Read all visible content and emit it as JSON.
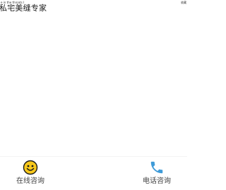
{
  "header": {
    "notice": "e in the throats I",
    "corner_link": "收藏",
    "brand_title": "私宅美缝专家"
  },
  "bottom_nav": {
    "online_label": "在线咨询",
    "phone_label": "电话咨询"
  },
  "colors": {
    "background": "#ffffff",
    "smiley_fill": "#f7c81c",
    "phone_icon": "#3f9bd8"
  },
  "icons": {
    "online": "smiley-face-icon",
    "phone": "phone-icon"
  }
}
